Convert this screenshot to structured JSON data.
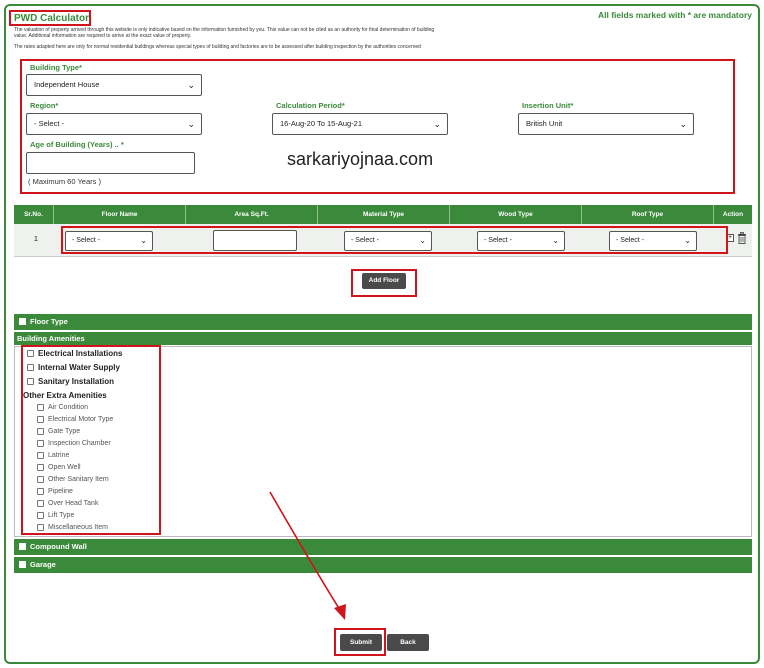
{
  "header": {
    "title": "PWD Calculator",
    "mandatory_note": "All fields marked with * are mandatory",
    "disclaimer_1": "The valuation of property arrived through this website is only indicative based on the information furnished by you. This value can not be cited as an authority for final determination of building",
    "disclaimer_2": "value. Additional information are required to arrive at the exact value of property.",
    "disclaimer_3": "The rates adapted here are only for normal residential buildings whereas special types of building and factories are to be assessed after building inspection by the authorities concerned"
  },
  "form": {
    "building_type_label": "Building Type*",
    "building_type_value": "Independent House",
    "region_label": "Region*",
    "region_value": "- Select -",
    "period_label": "Calculation Period*",
    "period_value": "16-Aug-20 To 15-Aug-21",
    "unit_label": "Insertion Unit*",
    "unit_value": "British Unit",
    "age_label": "Age of Building (Years) .. *",
    "age_hint": "( Maximum 60 Years )"
  },
  "watermark": "sarkariyojnaa.com",
  "floor_table": {
    "headers": [
      "Sr.No.",
      "Floor Name",
      "Area  Sq.Ft.",
      "Material Type",
      "Wood Type",
      "Roof Type",
      "Action"
    ],
    "rows": [
      {
        "sr_no": "1",
        "floor_name": "- Select -",
        "area": "",
        "material": "- Select -",
        "wood": "- Select -",
        "roof": "- Select -"
      }
    ]
  },
  "buttons": {
    "add_floor": "Add Floor",
    "submit": "Submit",
    "back": "Back"
  },
  "sections": {
    "floor_type": "Floor Type",
    "building_amenities": "Building Amenities",
    "compound_wall": "Compound Wall",
    "garage": "Garage"
  },
  "amenities": {
    "main": [
      "Electrical Installations",
      "Internal Water Supply",
      "Sanitary Installation"
    ],
    "extra_heading": "Other Extra Amenities",
    "extra": [
      "Air Condition",
      "Electrical Motor Type",
      "Gate Type",
      "Inspection Chamber",
      "Latrine",
      "Open Well",
      "Other Sanitary Item",
      "Pipeline",
      "Over Head Tank",
      "Lift Type",
      "Miscellaneous Item"
    ]
  },
  "icons": {
    "chevron": "chevron-down-icon",
    "add_row": "plus-square-icon",
    "delete_row": "trash-icon",
    "checkbox": "checkbox-icon"
  },
  "colors": {
    "accent_green": "#3b8a3b",
    "highlight_red": "#d0141c",
    "button_dark": "#4a4a4a"
  }
}
